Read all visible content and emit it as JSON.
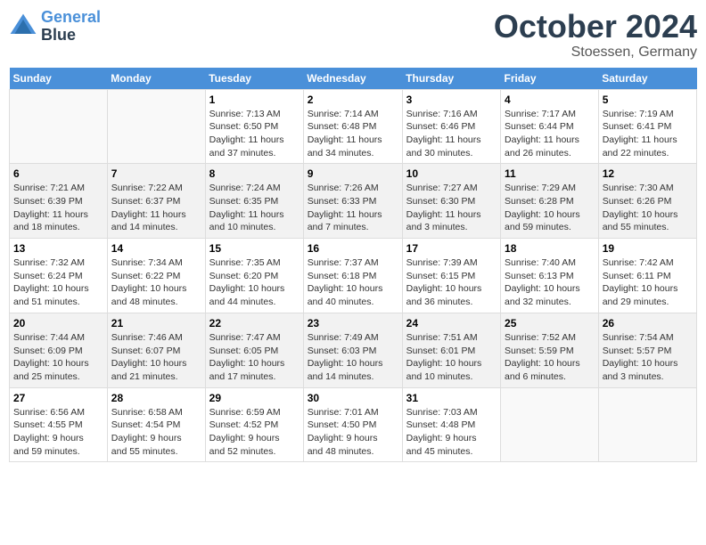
{
  "header": {
    "logo_line1": "General",
    "logo_line2": "Blue",
    "month": "October 2024",
    "location": "Stoessen, Germany"
  },
  "days_of_week": [
    "Sunday",
    "Monday",
    "Tuesday",
    "Wednesday",
    "Thursday",
    "Friday",
    "Saturday"
  ],
  "weeks": [
    [
      {
        "day": "",
        "info": ""
      },
      {
        "day": "",
        "info": ""
      },
      {
        "day": "1",
        "info": "Sunrise: 7:13 AM\nSunset: 6:50 PM\nDaylight: 11 hours\nand 37 minutes."
      },
      {
        "day": "2",
        "info": "Sunrise: 7:14 AM\nSunset: 6:48 PM\nDaylight: 11 hours\nand 34 minutes."
      },
      {
        "day": "3",
        "info": "Sunrise: 7:16 AM\nSunset: 6:46 PM\nDaylight: 11 hours\nand 30 minutes."
      },
      {
        "day": "4",
        "info": "Sunrise: 7:17 AM\nSunset: 6:44 PM\nDaylight: 11 hours\nand 26 minutes."
      },
      {
        "day": "5",
        "info": "Sunrise: 7:19 AM\nSunset: 6:41 PM\nDaylight: 11 hours\nand 22 minutes."
      }
    ],
    [
      {
        "day": "6",
        "info": "Sunrise: 7:21 AM\nSunset: 6:39 PM\nDaylight: 11 hours\nand 18 minutes."
      },
      {
        "day": "7",
        "info": "Sunrise: 7:22 AM\nSunset: 6:37 PM\nDaylight: 11 hours\nand 14 minutes."
      },
      {
        "day": "8",
        "info": "Sunrise: 7:24 AM\nSunset: 6:35 PM\nDaylight: 11 hours\nand 10 minutes."
      },
      {
        "day": "9",
        "info": "Sunrise: 7:26 AM\nSunset: 6:33 PM\nDaylight: 11 hours\nand 7 minutes."
      },
      {
        "day": "10",
        "info": "Sunrise: 7:27 AM\nSunset: 6:30 PM\nDaylight: 11 hours\nand 3 minutes."
      },
      {
        "day": "11",
        "info": "Sunrise: 7:29 AM\nSunset: 6:28 PM\nDaylight: 10 hours\nand 59 minutes."
      },
      {
        "day": "12",
        "info": "Sunrise: 7:30 AM\nSunset: 6:26 PM\nDaylight: 10 hours\nand 55 minutes."
      }
    ],
    [
      {
        "day": "13",
        "info": "Sunrise: 7:32 AM\nSunset: 6:24 PM\nDaylight: 10 hours\nand 51 minutes."
      },
      {
        "day": "14",
        "info": "Sunrise: 7:34 AM\nSunset: 6:22 PM\nDaylight: 10 hours\nand 48 minutes."
      },
      {
        "day": "15",
        "info": "Sunrise: 7:35 AM\nSunset: 6:20 PM\nDaylight: 10 hours\nand 44 minutes."
      },
      {
        "day": "16",
        "info": "Sunrise: 7:37 AM\nSunset: 6:18 PM\nDaylight: 10 hours\nand 40 minutes."
      },
      {
        "day": "17",
        "info": "Sunrise: 7:39 AM\nSunset: 6:15 PM\nDaylight: 10 hours\nand 36 minutes."
      },
      {
        "day": "18",
        "info": "Sunrise: 7:40 AM\nSunset: 6:13 PM\nDaylight: 10 hours\nand 32 minutes."
      },
      {
        "day": "19",
        "info": "Sunrise: 7:42 AM\nSunset: 6:11 PM\nDaylight: 10 hours\nand 29 minutes."
      }
    ],
    [
      {
        "day": "20",
        "info": "Sunrise: 7:44 AM\nSunset: 6:09 PM\nDaylight: 10 hours\nand 25 minutes."
      },
      {
        "day": "21",
        "info": "Sunrise: 7:46 AM\nSunset: 6:07 PM\nDaylight: 10 hours\nand 21 minutes."
      },
      {
        "day": "22",
        "info": "Sunrise: 7:47 AM\nSunset: 6:05 PM\nDaylight: 10 hours\nand 17 minutes."
      },
      {
        "day": "23",
        "info": "Sunrise: 7:49 AM\nSunset: 6:03 PM\nDaylight: 10 hours\nand 14 minutes."
      },
      {
        "day": "24",
        "info": "Sunrise: 7:51 AM\nSunset: 6:01 PM\nDaylight: 10 hours\nand 10 minutes."
      },
      {
        "day": "25",
        "info": "Sunrise: 7:52 AM\nSunset: 5:59 PM\nDaylight: 10 hours\nand 6 minutes."
      },
      {
        "day": "26",
        "info": "Sunrise: 7:54 AM\nSunset: 5:57 PM\nDaylight: 10 hours\nand 3 minutes."
      }
    ],
    [
      {
        "day": "27",
        "info": "Sunrise: 6:56 AM\nSunset: 4:55 PM\nDaylight: 9 hours\nand 59 minutes."
      },
      {
        "day": "28",
        "info": "Sunrise: 6:58 AM\nSunset: 4:54 PM\nDaylight: 9 hours\nand 55 minutes."
      },
      {
        "day": "29",
        "info": "Sunrise: 6:59 AM\nSunset: 4:52 PM\nDaylight: 9 hours\nand 52 minutes."
      },
      {
        "day": "30",
        "info": "Sunrise: 7:01 AM\nSunset: 4:50 PM\nDaylight: 9 hours\nand 48 minutes."
      },
      {
        "day": "31",
        "info": "Sunrise: 7:03 AM\nSunset: 4:48 PM\nDaylight: 9 hours\nand 45 minutes."
      },
      {
        "day": "",
        "info": ""
      },
      {
        "day": "",
        "info": ""
      }
    ]
  ]
}
